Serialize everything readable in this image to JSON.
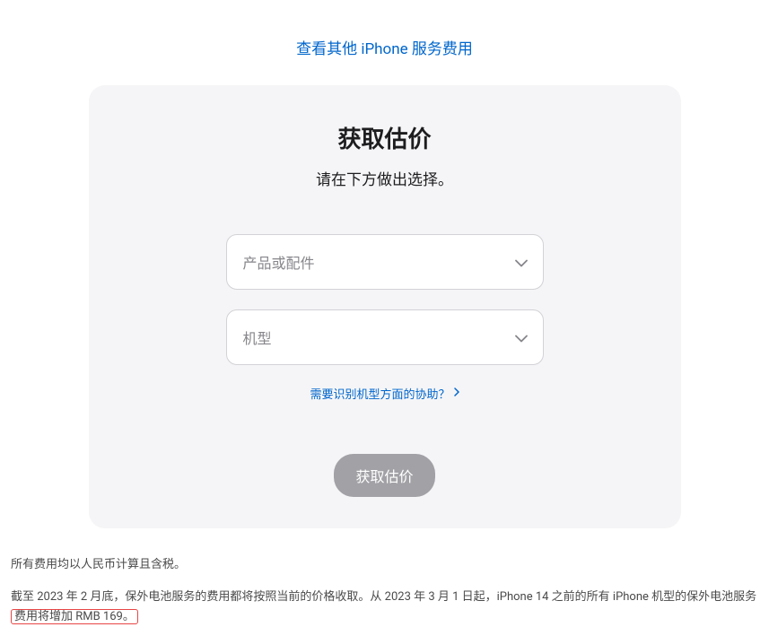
{
  "top_link": {
    "label": "查看其他 iPhone 服务费用"
  },
  "card": {
    "title": "获取估价",
    "subtitle": "请在下方做出选择。",
    "select_product_placeholder": "产品或配件",
    "select_model_placeholder": "机型",
    "help_link_label": "需要识别机型方面的协助？",
    "submit_label": "获取估价"
  },
  "footer": {
    "note1": "所有费用均以人民币计算且含税。",
    "note2_part1": "截至 2023 年 2 月底，保外电池服务的费用都将按照当前的价格收取。从 2023 年 3 月 1 日起，iPhone 14 之前的所有 iPhone 机型的保外电池服务",
    "note2_highlight": "费用将增加 RMB 169。"
  }
}
